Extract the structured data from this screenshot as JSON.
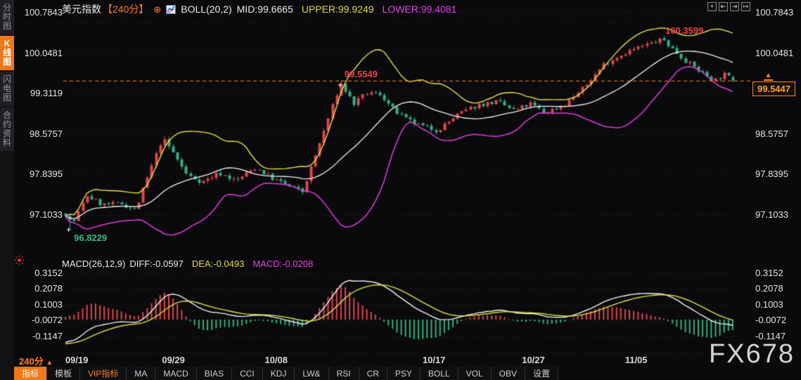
{
  "app": {
    "header": {
      "symbol": "美元指数",
      "interval": "【240分】",
      "add_icon": "⊕",
      "boll": "BOLL(20,2)",
      "mid": "MID:99.6665",
      "upper": "UPPER:99.9249",
      "lower": "LOWER:99.4081"
    },
    "sidebar": {
      "tabs": [
        {
          "label": "分时图",
          "active": false
        },
        {
          "label": "K线图",
          "active": true
        },
        {
          "label": "闪电图",
          "active": false
        },
        {
          "label": "合约资料",
          "active": false
        }
      ]
    },
    "top_icons": [
      {
        "name": "crosshair-icon",
        "glyph": "+"
      },
      {
        "name": "pan-left-icon",
        "glyph": "⇤"
      },
      {
        "name": "pan-right-icon",
        "glyph": "⇥"
      },
      {
        "name": "reset-scale-icon",
        "glyph": "↦"
      }
    ],
    "macd_header": {
      "title": "MACD(26,12,9)",
      "diff": "DIFF:-0.0597",
      "dea": "DEA:-0.0493",
      "macd": "MACD:-0.0208"
    },
    "period_selector": "240分",
    "period_selector_arrow": "▲",
    "toolbar": {
      "items": [
        {
          "label": "指标",
          "style": "active"
        },
        {
          "label": "模板",
          "style": ""
        },
        {
          "label": "VIP指标",
          "style": "vip"
        },
        {
          "label": "MA",
          "style": ""
        },
        {
          "label": "MACD",
          "style": ""
        },
        {
          "label": "BIAS",
          "style": ""
        },
        {
          "label": "CCI",
          "style": ""
        },
        {
          "label": "KDJ",
          "style": ""
        },
        {
          "label": "LW&",
          "style": ""
        },
        {
          "label": "RSI",
          "style": ""
        },
        {
          "label": "CR",
          "style": ""
        },
        {
          "label": "PSY",
          "style": ""
        },
        {
          "label": "BOLL",
          "style": ""
        },
        {
          "label": "VOL",
          "style": ""
        },
        {
          "label": "OBV",
          "style": ""
        },
        {
          "label": "设置",
          "style": ""
        }
      ]
    },
    "watermark": "FX678"
  },
  "chart_data": {
    "type": "candlestick+macd",
    "symbol": "美元指数",
    "interval": "240分",
    "boll": {
      "period": 20,
      "dev": 2,
      "mid": 99.6665,
      "upper": 99.9249,
      "lower": 99.4081
    },
    "macd_values": {
      "params": "26,12,9",
      "diff": -0.0597,
      "dea": -0.0493,
      "macd": -0.0208
    },
    "y_axis": [
      "100.7843",
      "100.0481",
      "99.3119",
      "98.5757",
      "97.8395",
      "97.1033"
    ],
    "macd_axis": [
      "0.3152",
      "0.2078",
      "0.1003",
      "-0.0072",
      "-0.1147"
    ],
    "x_ticks": [
      {
        "label": "09/19",
        "frac": 0.02
      },
      {
        "label": "09/29",
        "frac": 0.164
      },
      {
        "label": "10/08",
        "frac": 0.317
      },
      {
        "label": "10/17",
        "frac": 0.552
      },
      {
        "label": "10/27",
        "frac": 0.7
      },
      {
        "label": "11/05",
        "frac": 0.853
      }
    ],
    "annotations": {
      "peak_mid": {
        "text": "99.5549",
        "price": 99.5549,
        "frac": 0.412,
        "color": "red",
        "cross": true
      },
      "peak_right": {
        "text": "100.3599",
        "price": 100.3599,
        "frac": 0.895,
        "color": "red",
        "cross": false
      },
      "low_left": {
        "text": "96.8229",
        "price": 96.8229,
        "frac": 0.008,
        "color": "green",
        "cross": true
      },
      "last": {
        "text": "99.5447",
        "price": 99.5447
      }
    },
    "price_path_anchors": [
      [
        0.0,
        97.12
      ],
      [
        0.01,
        96.92
      ],
      [
        0.032,
        97.45
      ],
      [
        0.055,
        97.28
      ],
      [
        0.085,
        97.3
      ],
      [
        0.105,
        97.18
      ],
      [
        0.125,
        97.85
      ],
      [
        0.145,
        98.5
      ],
      [
        0.162,
        98.22
      ],
      [
        0.182,
        97.82
      ],
      [
        0.205,
        97.7
      ],
      [
        0.23,
        97.86
      ],
      [
        0.255,
        97.72
      ],
      [
        0.285,
        97.96
      ],
      [
        0.31,
        97.76
      ],
      [
        0.335,
        97.62
      ],
      [
        0.355,
        97.52
      ],
      [
        0.375,
        98.2
      ],
      [
        0.412,
        99.5
      ],
      [
        0.432,
        99.12
      ],
      [
        0.452,
        99.32
      ],
      [
        0.472,
        99.3
      ],
      [
        0.492,
        99.0
      ],
      [
        0.512,
        98.82
      ],
      [
        0.537,
        98.7
      ],
      [
        0.557,
        98.64
      ],
      [
        0.587,
        98.92
      ],
      [
        0.617,
        99.1
      ],
      [
        0.647,
        99.16
      ],
      [
        0.672,
        99.0
      ],
      [
        0.697,
        99.12
      ],
      [
        0.717,
        98.96
      ],
      [
        0.747,
        99.1
      ],
      [
        0.777,
        99.42
      ],
      [
        0.807,
        99.85
      ],
      [
        0.837,
        100.05
      ],
      [
        0.862,
        100.16
      ],
      [
        0.895,
        100.3
      ],
      [
        0.915,
        100.06
      ],
      [
        0.935,
        99.85
      ],
      [
        0.955,
        99.68
      ],
      [
        0.972,
        99.55
      ],
      [
        0.988,
        99.66
      ],
      [
        1.0,
        99.5447
      ]
    ],
    "candle_count": 156,
    "seed": 7,
    "noise": {
      "close": 0.045,
      "wick": 0.05
    },
    "colors": {
      "up": "#e2454d",
      "down": "#33ae85",
      "boll_upper": "#e3e33e",
      "boll_mid": "#f5f5f5",
      "boll_lower": "#e03ce0",
      "diff_line": "#f5f5f5",
      "dea_line": "#e3e33e",
      "hist_pos": "#e2454d",
      "hist_neg": "#33ae85",
      "accent_orange": "#ff8a1a",
      "grid": "#2b2b31"
    }
  }
}
